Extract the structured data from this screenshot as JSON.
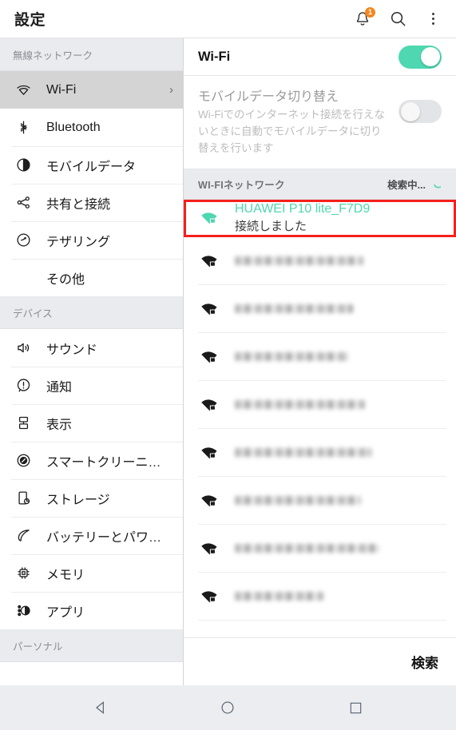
{
  "appbar": {
    "title": "設定",
    "notifications_icon": "bell-icon",
    "notifications_badge": "1",
    "search_icon": "search-icon",
    "overflow_icon": "more-vertical-icon"
  },
  "sidebar": {
    "sections": [
      {
        "header": "無線ネットワーク",
        "items": [
          {
            "label": "Wi-Fi",
            "icon": "wifi-icon",
            "active": true,
            "chevron": "›"
          },
          {
            "label": "Bluetooth",
            "icon": "bluetooth-icon",
            "active": false
          },
          {
            "label": "モバイルデータ",
            "icon": "mobile-data-icon",
            "active": false
          },
          {
            "label": "共有と接続",
            "icon": "share-icon",
            "active": false
          },
          {
            "label": "テザリング",
            "icon": "tethering-icon",
            "active": false
          },
          {
            "label": "その他",
            "icon": "none",
            "active": false
          }
        ]
      },
      {
        "header": "デバイス",
        "items": [
          {
            "label": "サウンド",
            "icon": "speaker-icon",
            "active": false
          },
          {
            "label": "通知",
            "icon": "notification-icon",
            "active": false
          },
          {
            "label": "表示",
            "icon": "display-icon",
            "active": false
          },
          {
            "label": "スマートクリーニ…",
            "icon": "smart-clean-icon",
            "active": false
          },
          {
            "label": "ストレージ",
            "icon": "storage-icon",
            "active": false
          },
          {
            "label": "バッテリーとパワ…",
            "icon": "battery-icon",
            "active": false
          },
          {
            "label": "メモリ",
            "icon": "memory-chip-icon",
            "active": false
          },
          {
            "label": "アプリ",
            "icon": "apps-icon",
            "active": false
          }
        ]
      },
      {
        "header": "パーソナル",
        "items": []
      }
    ]
  },
  "wifi_panel": {
    "title": "Wi-Fi",
    "toggle_on": true,
    "toggle_accent": "#4ED7B0",
    "mobile_switch": {
      "title": "モバイルデータ切り替え",
      "description": "Wi-Fiでのインターネット接続を行えないときに自動でモバイルデータに切り替えを行います",
      "toggle_on": false
    },
    "list_header": {
      "label": "WI-FIネットワーク",
      "status": "検索中...",
      "spinner_icon": "spinner-icon"
    },
    "networks": [
      {
        "ssid": "HUAWEI P10 lite_F7D9",
        "status": "接続しました",
        "icon": "wifi-lock-icon",
        "highlighted": true,
        "highlight_color": "#F5201C",
        "redacted": false
      },
      {
        "ssid": "",
        "status": "",
        "icon": "wifi-lock-icon",
        "highlighted": false,
        "redacted": true,
        "blur_width": "62%"
      },
      {
        "ssid": "",
        "status": "",
        "icon": "wifi-lock-icon",
        "highlighted": false,
        "redacted": true,
        "blur_width": "57%"
      },
      {
        "ssid": "",
        "status": "",
        "icon": "wifi-lock-icon",
        "highlighted": false,
        "redacted": true,
        "blur_width": "55%"
      },
      {
        "ssid": "",
        "status": "",
        "icon": "wifi-lock-icon",
        "highlighted": false,
        "redacted": true,
        "blur_width": "63%"
      },
      {
        "ssid": "",
        "status": "",
        "icon": "wifi-lock-icon",
        "highlighted": false,
        "redacted": true,
        "blur_width": "66%"
      },
      {
        "ssid": "",
        "status": "",
        "icon": "wifi-lock-icon",
        "highlighted": false,
        "redacted": true,
        "blur_width": "61%"
      },
      {
        "ssid": "",
        "status": "",
        "icon": "wifi-lock-icon",
        "highlighted": false,
        "redacted": true,
        "blur_width": "70%"
      },
      {
        "ssid": "",
        "status": "",
        "icon": "wifi-lock-icon",
        "highlighted": false,
        "redacted": true,
        "blur_width": "43%"
      }
    ],
    "search_button": "検索"
  },
  "navbar": {
    "back_icon": "back-triangle-icon",
    "home_icon": "home-circle-icon",
    "recents_icon": "recents-square-icon"
  }
}
